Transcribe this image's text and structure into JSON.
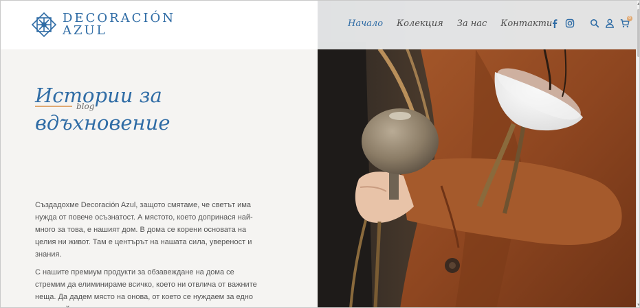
{
  "brand": {
    "line1": "DECORACIÓN",
    "line2": "AZUL",
    "logo_icon": "snowflake-ornament-icon",
    "color": "#2f6ca5"
  },
  "nav": {
    "items": [
      {
        "label": "Начало",
        "active": true
      },
      {
        "label": "Колекция",
        "active": false
      },
      {
        "label": "За нас",
        "active": false
      },
      {
        "label": "Контакти",
        "active": false
      }
    ],
    "social_icons": [
      "facebook-icon",
      "instagram-icon"
    ],
    "utility_icons": [
      "search-icon",
      "user-icon",
      "cart-icon"
    ],
    "cart_count": "0"
  },
  "hero": {
    "kicker": "blog",
    "headline_line1": "Истории за",
    "headline_line2": "вдъхновение",
    "paragraph1": "Създадохме Decoración Azul, защото смятаме, че светът има нужда от повече осъзнатост. А мястото, което допринася най-много за това, е нашият дом. В дома се корени основата на целия ни живот. Там е центърът на нашата сила, увереност и знания.",
    "paragraph2": "С нашите премиум продукти за обзавеждане на дома се стремим да елиминираме всичко, което ни отвлича от важните неща. Да дадем място на онова, от което се нуждаем за едно по-спокойно ежедневие и по-щастлив живот.",
    "accent_color": "#e0a872",
    "panel_color": "#f5f4f2"
  }
}
